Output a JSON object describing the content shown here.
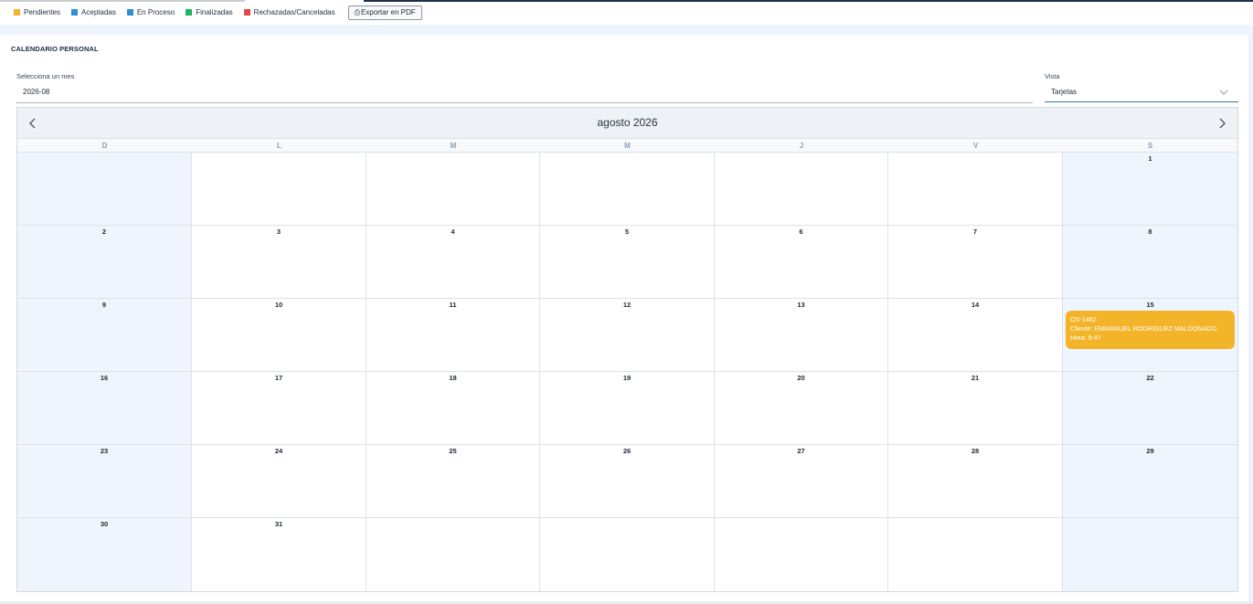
{
  "legend": {
    "items": [
      {
        "label": "Pendientes",
        "color": "#f4b429"
      },
      {
        "label": "Aceptadas",
        "color": "#2d8fd8"
      },
      {
        "label": "En Proceso",
        "color": "#2d8fd8"
      },
      {
        "label": "Finalizadas",
        "color": "#22b55a"
      },
      {
        "label": "Rechazadas/Canceladas",
        "color": "#e04848"
      }
    ],
    "export_button": {
      "icon": "printer-icon",
      "glyph": "⎙",
      "label": "Exportar en PDF"
    }
  },
  "card": {
    "title": "CALENDARIO PERSONAL"
  },
  "filters": {
    "month_label": "Selecciona un mes",
    "month_value": "2026-08",
    "view_label": "Vista",
    "view_value": "Tarjetas"
  },
  "calendar": {
    "title": "agosto 2026",
    "prev_icon": "chevron-left-icon",
    "next_icon": "chevron-right-icon",
    "weekdays": [
      "D",
      "L",
      "M",
      "M",
      "J",
      "V",
      "S"
    ],
    "first_weekday_index": 6,
    "days_in_month": 31,
    "weeks": 6,
    "events": [
      {
        "day": 15,
        "status": "Pendientes",
        "color": "#f4b429",
        "code": "OS-1482",
        "client": "Cliente: EMMANUEL RODRIGUEZ MALDONADO",
        "time": "Hora: 9:47"
      }
    ]
  }
}
